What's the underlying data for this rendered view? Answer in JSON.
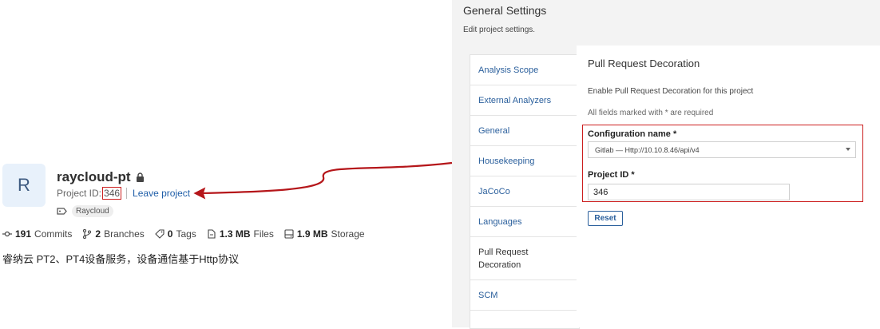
{
  "project": {
    "avatar_letter": "R",
    "name": "raycloud-pt",
    "id_label": "Project ID: ",
    "id_value": "346",
    "leave_label": "Leave project",
    "topic": "Raycloud",
    "stats": {
      "commits": "191",
      "commits_label": "Commits",
      "branches": "2",
      "branches_label": "Branches",
      "tags": "0",
      "tags_label": "Tags",
      "files": "1.3 MB",
      "files_label": "Files",
      "storage": "1.9 MB",
      "storage_label": "Storage"
    },
    "description": "睿纳云 PT2、PT4设备服务，设备通信基于Http协议"
  },
  "settings": {
    "title": "General Settings",
    "subtitle": "Edit project settings.",
    "categories": [
      "Analysis Scope",
      "External Analyzers",
      "General",
      "Housekeeping",
      "JaCoCo",
      "Languages",
      "Pull Request Decoration",
      "SCM"
    ],
    "detail": {
      "title": "Pull Request Decoration",
      "description": "Enable Pull Request Decoration for this project",
      "required_note": "All fields marked with * are required",
      "config_label": "Configuration name *",
      "config_value": "Gitlab — Http://10.10.8.46/api/v4",
      "project_id_label": "Project ID *",
      "project_id_value": "346",
      "reset_label": "Reset"
    }
  },
  "colors": {
    "highlight": "#cc1f1f",
    "link": "#2a5f9c"
  }
}
